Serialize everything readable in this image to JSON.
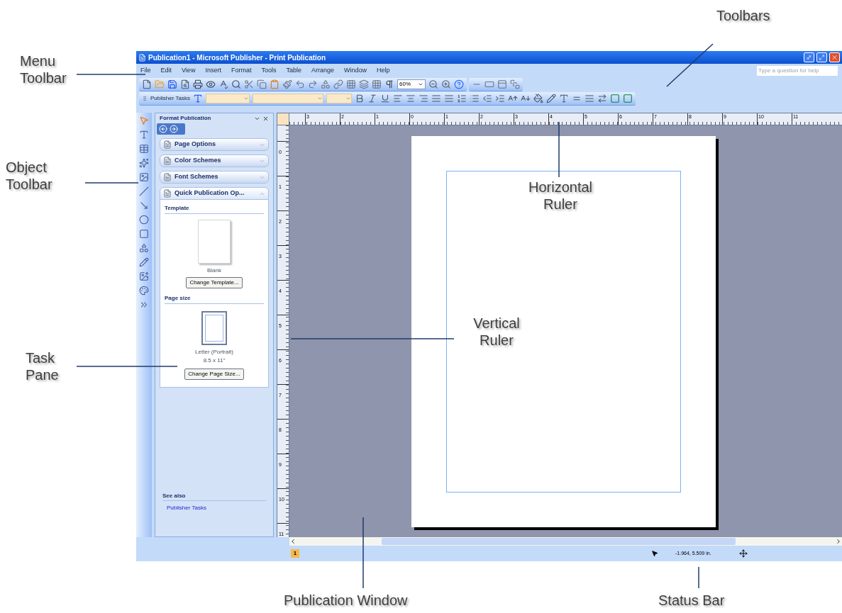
{
  "annotations": [
    {
      "label": "Toolbars"
    },
    {
      "label": "Menu Toolbar"
    },
    {
      "label": "Object Toolbar"
    },
    {
      "label": "Horizontal Ruler"
    },
    {
      "label": "Vertical Ruler"
    },
    {
      "label": "Task Pane"
    },
    {
      "label": "Publication Window"
    },
    {
      "label": "Status Bar"
    }
  ],
  "window": {
    "title": "Publication1 - Microsoft Publisher - Print Publication"
  },
  "menu": [
    "File",
    "Edit",
    "View",
    "Insert",
    "Format",
    "Tools",
    "Table",
    "Arrange",
    "Window",
    "Help"
  ],
  "help_box": {
    "placeholder": "Type a question for help"
  },
  "standard_toolbar": {
    "zoom": "60%"
  },
  "formatting_toolbar": {
    "tasks_button": "Publisher Tasks"
  },
  "task_pane": {
    "title": "Format Publication",
    "sections": [
      {
        "label": "Page Options",
        "expanded": false
      },
      {
        "label": "Color Schemes",
        "expanded": false
      },
      {
        "label": "Font Schemes",
        "expanded": false
      },
      {
        "label": "Quick Publication Op...",
        "expanded": true
      }
    ],
    "template": {
      "heading": "Template",
      "name": "Blank",
      "button": "Change Template..."
    },
    "page_size": {
      "heading": "Page size",
      "name": "Letter (Portrait)",
      "dimensions": "8.5 x 11\"",
      "button": "Change Page Size..."
    },
    "see_also": {
      "heading": "See also",
      "links": [
        "Publisher Tasks"
      ]
    }
  },
  "horizontal_ruler": [
    "3",
    "2",
    "1",
    "0",
    "1",
    "2",
    "3",
    "4",
    "5",
    "6",
    "7",
    "8",
    "9",
    "10",
    "11"
  ],
  "vertical_ruler": [
    "0",
    "1",
    "2",
    "3",
    "4",
    "5",
    "6",
    "7",
    "8",
    "9",
    "10",
    "11"
  ],
  "status_bar": {
    "page": "1",
    "position": "-1.964, 5.509 in."
  }
}
